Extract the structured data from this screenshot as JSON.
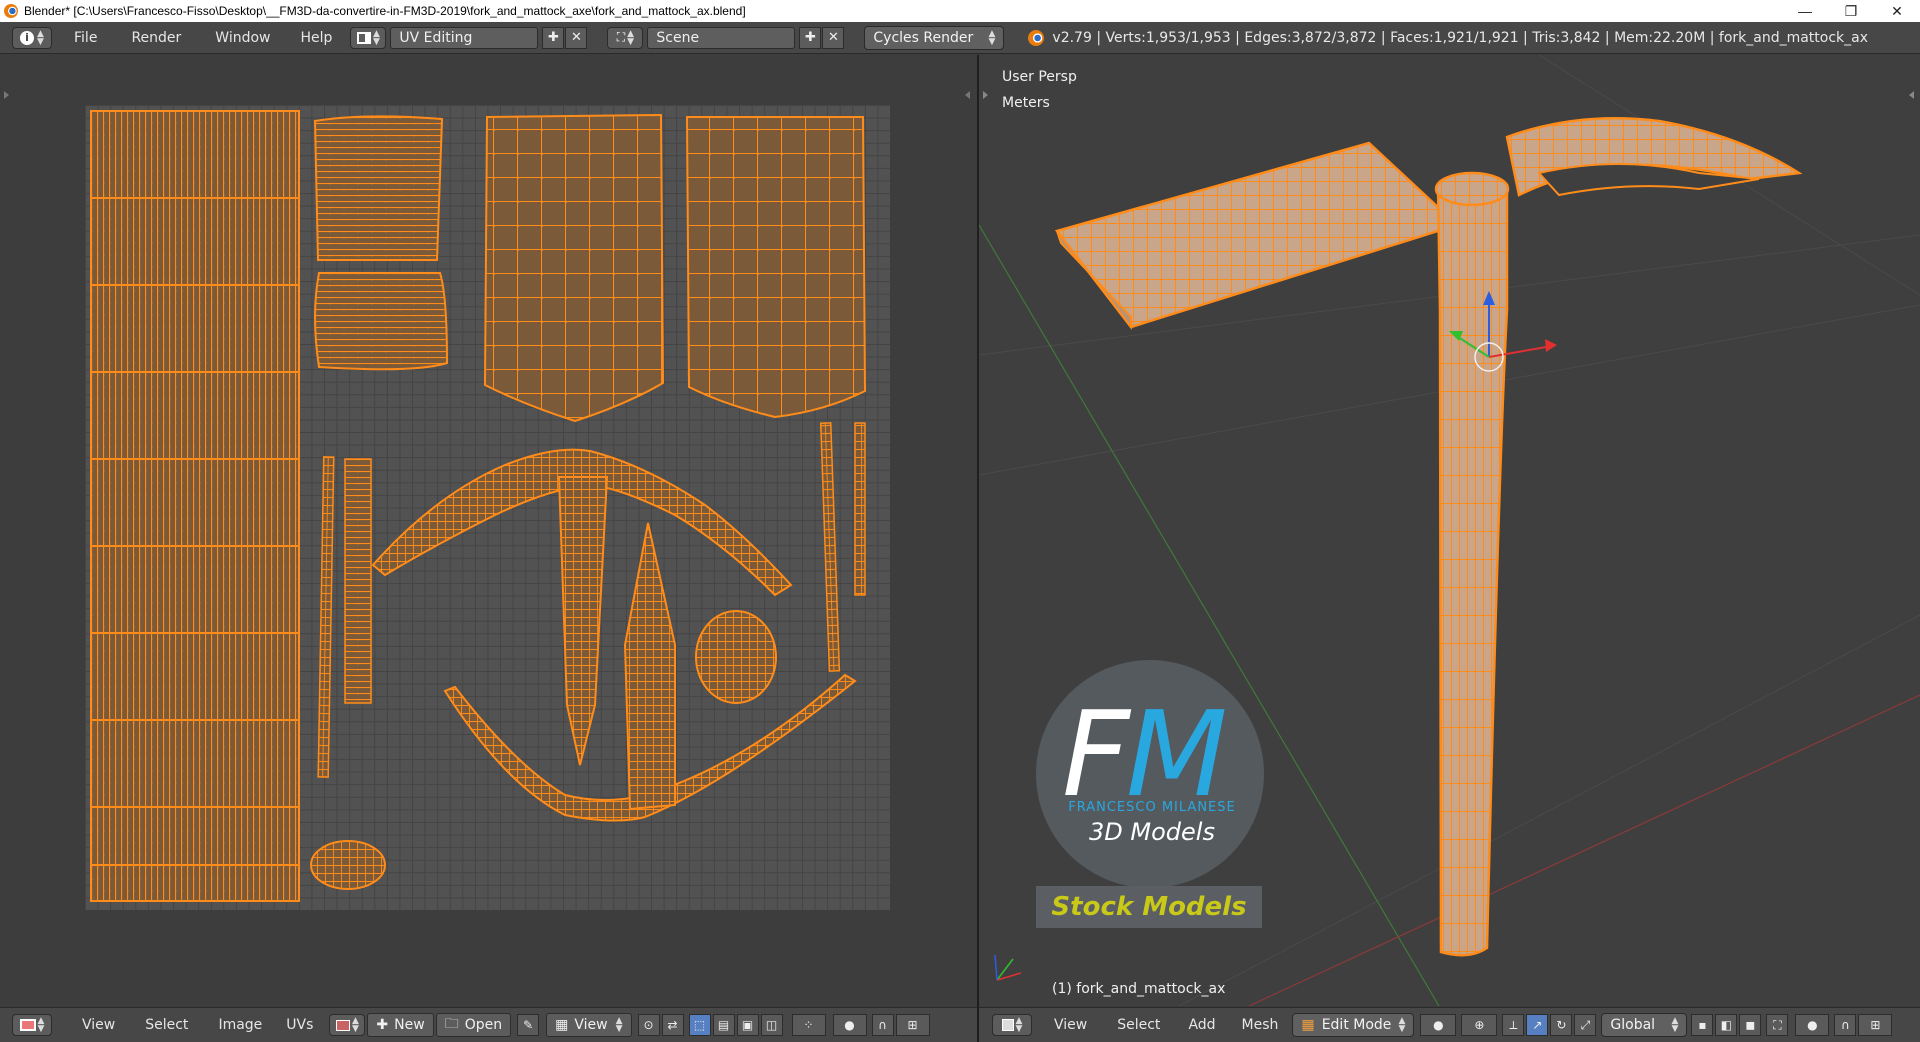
{
  "window": {
    "title": "Blender* [C:\\Users\\Francesco-Fisso\\Desktop\\__FM3D-da-convertire-in-FM3D-2019\\fork_and_mattock_axe\\fork_and_mattock_ax.blend]",
    "minimize": "—",
    "restore": "❐",
    "close": "✕"
  },
  "info_header": {
    "menus": [
      "File",
      "Render",
      "Window",
      "Help"
    ],
    "screen_layout": "UV Editing",
    "scene": "Scene",
    "render_engine": "Cycles Render",
    "stats": "v2.79 | Verts:1,953/1,953 | Edges:3,872/3,872 | Faces:1,921/1,921 | Tris:3,842 | Mem:22.20M | fork_and_mattock_ax"
  },
  "uv_header": {
    "menus": [
      "View",
      "Select",
      "Image",
      "UVs"
    ],
    "new_label": "New",
    "open_label": "Open",
    "view_label": "View"
  },
  "viewport": {
    "view_name": "User Persp",
    "units": "Meters",
    "object_label": "(1) fork_and_mattock_ax"
  },
  "view3d_header": {
    "menus": [
      "View",
      "Select",
      "Add",
      "Mesh"
    ],
    "mode": "Edit Mode",
    "orientation": "Global"
  },
  "logo": {
    "letters_f": "F",
    "letters_m": "M",
    "name": "FRANCESCO MILANESE",
    "subtitle": "3D Models",
    "banner": "Stock Models"
  },
  "colors": {
    "mesh_edge": "#ff8c1a",
    "uv_fill": "#7a5a38",
    "mesh_fill": "#c9a58a",
    "logo_blue": "#29a8df",
    "banner_yellow": "#c8c919"
  }
}
